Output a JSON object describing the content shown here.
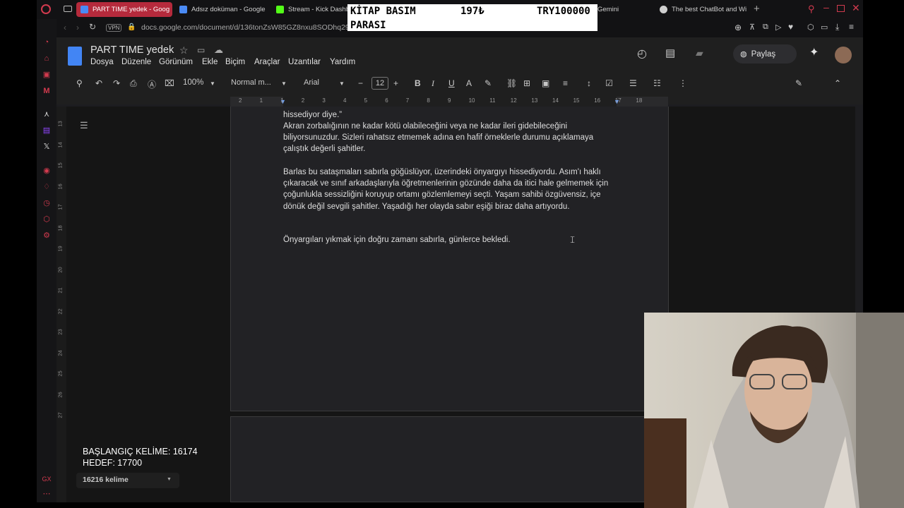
{
  "tabs": [
    {
      "label": "PART TIME yedek - Goog",
      "active": true
    },
    {
      "label": "Adsız doküman - Google",
      "active": false
    },
    {
      "label": "Stream - Kick Dashb",
      "active": false
    },
    {
      "label": "Gemini",
      "active": false
    },
    {
      "label": "The best ChatBot and Wi",
      "active": false
    }
  ],
  "address": {
    "vpn": "VPN",
    "url": "docs.google.com/document/d/136tonZsW85GZ8nxu8SODhq29ey"
  },
  "doc": {
    "title": "PART TIME yedek",
    "menu": [
      "Dosya",
      "Düzenle",
      "Görünüm",
      "Ekle",
      "Biçim",
      "Araçlar",
      "Uzantılar",
      "Yardım"
    ],
    "share_label": "Paylaş"
  },
  "toolbar": {
    "zoom": "100%",
    "style": "Normal m...",
    "font": "Arial",
    "font_size": "12"
  },
  "ruler_ticks": [
    "2",
    "1",
    "1",
    "2",
    "3",
    "4",
    "5",
    "6",
    "7",
    "8",
    "9",
    "10",
    "11",
    "12",
    "13",
    "14",
    "15",
    "16",
    "17",
    "18"
  ],
  "vruler_ticks": [
    "13",
    "14",
    "15",
    "16",
    "17",
    "18",
    "19",
    "20",
    "21",
    "22",
    "23",
    "24",
    "25",
    "26",
    "27"
  ],
  "body": {
    "p0": "hissediyor diye.”",
    "p1": "Akran zorbalığının ne kadar kötü olabileceğini veya ne kadar ileri gidebileceğini biliyorsunuzdur. Sizleri rahatsız etmemek adına en hafif örneklerle durumu açıklamaya çalıştık değerli şahitler.",
    "p2": "Barlas bu sataşmaları sabırla göğüslüyor, üzerindeki önyargıyı hissediyordu. Asım'ı haklı çıkaracak ve sınıf arkadaşlarıyla öğretmenlerinin gözünde daha da itici hale gelmemek için çoğunlukla sessizliğini koruyup ortamı gözlemlemeyi seçti. Yaşam sahibi özgüvensiz, içe dönük değil sevgili şahitler. Yaşadığı her olayda sabır eşiği biraz daha artıyordu.",
    "p3": "Önyargıları yıkmak için doğru zamanı sabırla, günlerce bekledi."
  },
  "word_count": "16216 kelime",
  "overlay": {
    "kitap_line1": "KİTAP BASIM",
    "kitap_line2": "PARASI",
    "kitap_price": "197₺",
    "kitap_target": "TRY100000",
    "start_words": "BAŞLANGIÇ KELİME: 16174",
    "target_words": "HEDEF: 17700"
  },
  "colors": {
    "accent": "#d23a4e",
    "doc_blue": "#4285f4"
  }
}
